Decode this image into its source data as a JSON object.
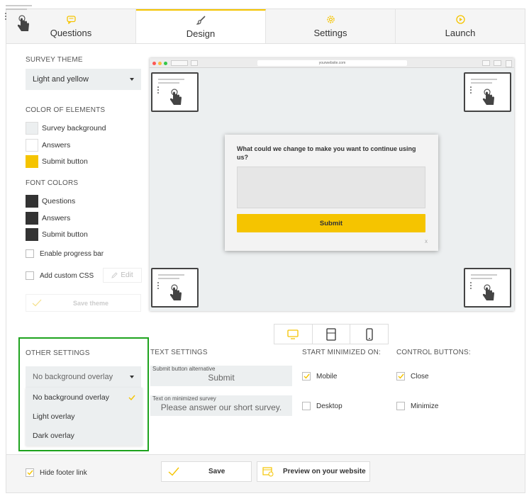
{
  "tabs": [
    {
      "label": "Questions",
      "icon": "chat-icon"
    },
    {
      "label": "Design",
      "icon": "brush-icon"
    },
    {
      "label": "Settings",
      "icon": "gear-icon"
    },
    {
      "label": "Launch",
      "icon": "play-icon"
    }
  ],
  "active_tab": "Design",
  "theme": {
    "heading": "SURVEY THEME",
    "value": "Light and yellow"
  },
  "element_colors": {
    "heading": "COLOR OF ELEMENTS",
    "items": [
      {
        "label": "Survey background",
        "color": "#eceff0"
      },
      {
        "label": "Answers",
        "color": "#ffffff"
      },
      {
        "label": "Submit button",
        "color": "#f5c400"
      }
    ]
  },
  "font_colors": {
    "heading": "FONT COLORS",
    "items": [
      {
        "label": "Questions",
        "color": "#333333"
      },
      {
        "label": "Answers",
        "color": "#333333"
      },
      {
        "label": "Submit button",
        "color": "#333333"
      }
    ]
  },
  "progress_bar": {
    "label": "Enable progress bar",
    "checked": false
  },
  "custom_css": {
    "label": "Add custom CSS",
    "checked": false,
    "edit_label": "Edit"
  },
  "save_theme_label": "Save theme",
  "preview": {
    "url": "yourwebsite.com",
    "question": "What could we change to make you want to continue using us?",
    "submit_label": "Submit",
    "close_label": "x"
  },
  "other_settings": {
    "heading": "OTHER SETTINGS",
    "value": "No background overlay",
    "options": [
      "No background overlay",
      "Light overlay",
      "Dark overlay"
    ],
    "selected_index": 0
  },
  "text_settings": {
    "heading": "TEXT SETTINGS",
    "submit_alt": {
      "label": "Submit button alternative",
      "value": "Submit"
    },
    "minimized_text": {
      "label": "Text on minimized survey",
      "value": "Please answer our short survey."
    }
  },
  "start_minimized": {
    "heading": "START MINIMIZED ON:",
    "options": [
      {
        "label": "Mobile",
        "checked": true
      },
      {
        "label": "Desktop",
        "checked": false
      }
    ]
  },
  "control_buttons": {
    "heading": "CONTROL BUTTONS:",
    "options": [
      {
        "label": "Close",
        "checked": true
      },
      {
        "label": "Minimize",
        "checked": false
      }
    ]
  },
  "footer": {
    "hide_footer_link": {
      "label": "Hide footer link",
      "checked": true
    },
    "save_label": "Save",
    "preview_label": "Preview on your website"
  },
  "colors": {
    "accent": "#f5c400",
    "highlight_border": "#1ea31e"
  }
}
